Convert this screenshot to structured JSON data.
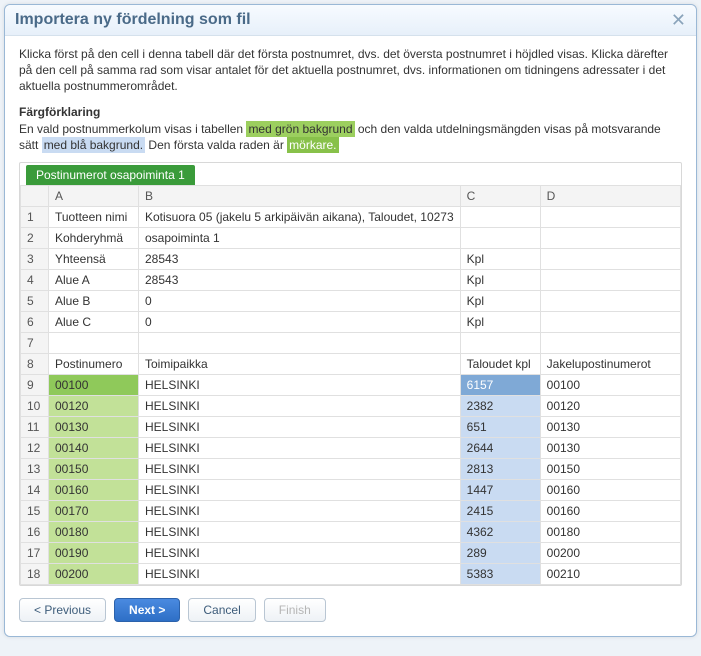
{
  "dialog": {
    "title": "Importera ny fördelning som fil",
    "description": "Klicka först på den cell i denna tabell där det första postnumret, dvs. det översta postnumret i höjdled visas. Klicka därefter på den cell på samma rad som visar antalet för det aktuella postnumret, dvs. informationen om tidningens adressater i det aktuella postnummerområdet.",
    "legend_heading": "Färgförklaring",
    "legend_prefix": "En vald postnummerkolum visas i tabellen ",
    "legend_green": "med grön bakgrund",
    "legend_mid": " och den valda utdelningsmängden visas på motsvarande sätt ",
    "legend_blue": "med blå bakgrund.",
    "legend_suffix1": " Den första valda raden är ",
    "legend_darker": "mörkare.",
    "tab": "Postinumerot osapoiminta 1"
  },
  "columns": {
    "A": "A",
    "B": "B",
    "C": "C",
    "D": "D"
  },
  "rows": [
    {
      "n": 1,
      "a": "Tuotteen nimi",
      "b": "Kotisuora 05 (jakelu 5 arkipäivän aikana), Taloudet, 10273",
      "c": "",
      "d": ""
    },
    {
      "n": 2,
      "a": "Kohderyhmä",
      "b": "osapoiminta 1",
      "c": "",
      "d": ""
    },
    {
      "n": 3,
      "a": "Yhteensä",
      "b": "28543",
      "c": "Kpl",
      "d": ""
    },
    {
      "n": 4,
      "a": "Alue A",
      "b": "28543",
      "c": "Kpl",
      "d": ""
    },
    {
      "n": 5,
      "a": "Alue B",
      "b": "0",
      "c": "Kpl",
      "d": ""
    },
    {
      "n": 6,
      "a": "Alue C",
      "b": "0",
      "c": "Kpl",
      "d": ""
    },
    {
      "n": 7,
      "a": "",
      "b": "",
      "c": "",
      "d": ""
    },
    {
      "n": 8,
      "a": "Postinumero",
      "b": "Toimipaikka",
      "c": "Taloudet kpl",
      "d": "Jakelupostinumerot"
    },
    {
      "n": 9,
      "a": "00100",
      "b": "HELSINKI",
      "c": "6157",
      "d": "00100",
      "sel": "first"
    },
    {
      "n": 10,
      "a": "00120",
      "b": "HELSINKI",
      "c": "2382",
      "d": "00120",
      "sel": "row"
    },
    {
      "n": 11,
      "a": "00130",
      "b": "HELSINKI",
      "c": "651",
      "d": "00130",
      "sel": "row"
    },
    {
      "n": 12,
      "a": "00140",
      "b": "HELSINKI",
      "c": "2644",
      "d": "00130",
      "sel": "row"
    },
    {
      "n": 13,
      "a": "00150",
      "b": "HELSINKI",
      "c": "2813",
      "d": "00150",
      "sel": "row"
    },
    {
      "n": 14,
      "a": "00160",
      "b": "HELSINKI",
      "c": "1447",
      "d": "00160",
      "sel": "row"
    },
    {
      "n": 15,
      "a": "00170",
      "b": "HELSINKI",
      "c": "2415",
      "d": "00160",
      "sel": "row"
    },
    {
      "n": 16,
      "a": "00180",
      "b": "HELSINKI",
      "c": "4362",
      "d": "00180",
      "sel": "row"
    },
    {
      "n": 17,
      "a": "00190",
      "b": "HELSINKI",
      "c": "289",
      "d": "00200",
      "sel": "row"
    },
    {
      "n": 18,
      "a": "00200",
      "b": "HELSINKI",
      "c": "5383",
      "d": "00210",
      "sel": "row"
    }
  ],
  "buttons": {
    "previous": "< Previous",
    "next": "Next >",
    "cancel": "Cancel",
    "finish": "Finish"
  }
}
